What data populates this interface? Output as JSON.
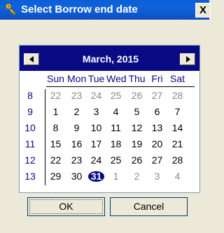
{
  "window": {
    "title": "Select Borrow end date",
    "close_label": "X"
  },
  "calendar": {
    "month_label": "March, 2015",
    "days_of_week": [
      "Sun",
      "Mon",
      "Tue",
      "Wed",
      "Thu",
      "Fri",
      "Sat"
    ],
    "weeks": [
      {
        "week_no": "8",
        "days": [
          {
            "d": "22",
            "other": true
          },
          {
            "d": "23",
            "other": true
          },
          {
            "d": "24",
            "other": true
          },
          {
            "d": "25",
            "other": true
          },
          {
            "d": "26",
            "other": true
          },
          {
            "d": "27",
            "other": true
          },
          {
            "d": "28",
            "other": true
          }
        ]
      },
      {
        "week_no": "9",
        "days": [
          {
            "d": "1"
          },
          {
            "d": "2"
          },
          {
            "d": "3"
          },
          {
            "d": "4"
          },
          {
            "d": "5"
          },
          {
            "d": "6"
          },
          {
            "d": "7"
          }
        ]
      },
      {
        "week_no": "10",
        "days": [
          {
            "d": "8"
          },
          {
            "d": "9"
          },
          {
            "d": "10"
          },
          {
            "d": "11"
          },
          {
            "d": "12"
          },
          {
            "d": "13"
          },
          {
            "d": "14"
          }
        ]
      },
      {
        "week_no": "11",
        "days": [
          {
            "d": "15"
          },
          {
            "d": "16"
          },
          {
            "d": "17"
          },
          {
            "d": "18"
          },
          {
            "d": "19"
          },
          {
            "d": "20"
          },
          {
            "d": "21"
          }
        ]
      },
      {
        "week_no": "12",
        "days": [
          {
            "d": "22"
          },
          {
            "d": "23"
          },
          {
            "d": "24"
          },
          {
            "d": "25"
          },
          {
            "d": "26"
          },
          {
            "d": "27"
          },
          {
            "d": "28"
          }
        ]
      },
      {
        "week_no": "13",
        "days": [
          {
            "d": "29"
          },
          {
            "d": "30"
          },
          {
            "d": "31",
            "selected": true
          },
          {
            "d": "1",
            "other": true
          },
          {
            "d": "2",
            "other": true
          },
          {
            "d": "3",
            "other": true
          },
          {
            "d": "4",
            "other": true
          }
        ]
      }
    ],
    "colors": {
      "header_bg": "#0a0a84",
      "accent": "#0a0a84",
      "other_month": "#8a8a8a"
    }
  },
  "buttons": {
    "ok_label": "OK",
    "cancel_label": "Cancel"
  },
  "icons": {
    "title_icon": "key-icon",
    "prev": "triangle-left-icon",
    "next": "triangle-right-icon"
  }
}
